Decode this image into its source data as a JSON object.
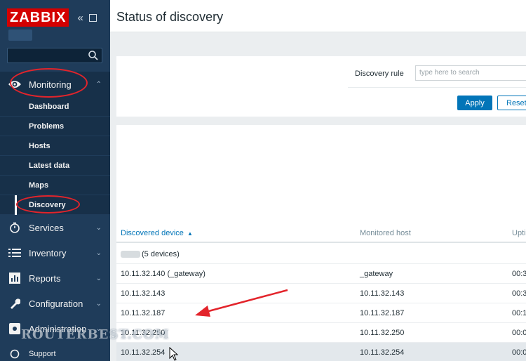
{
  "app": {
    "logo": "ZABBIX",
    "collapse_icon": "«",
    "kiosk_icon": "□"
  },
  "sidebar": {
    "search_placeholder": "",
    "items": [
      {
        "label": "Monitoring",
        "icon": "eye-icon",
        "chevron": "⌃",
        "expanded": true,
        "children": [
          {
            "label": "Dashboard"
          },
          {
            "label": "Problems"
          },
          {
            "label": "Hosts"
          },
          {
            "label": "Latest data"
          },
          {
            "label": "Maps"
          },
          {
            "label": "Discovery",
            "selected": true
          }
        ]
      },
      {
        "label": "Services",
        "icon": "stopwatch-icon",
        "chevron": "⌄"
      },
      {
        "label": "Inventory",
        "icon": "list-icon",
        "chevron": "⌄"
      },
      {
        "label": "Reports",
        "icon": "bar-chart-icon",
        "chevron": "⌄"
      },
      {
        "label": "Configuration",
        "icon": "wrench-icon",
        "chevron": "⌄"
      },
      {
        "label": "Administration",
        "icon": "gear-icon",
        "chevron": "⌄"
      },
      {
        "label": "Support",
        "icon": "support-icon",
        "chevron": ""
      }
    ]
  },
  "header": {
    "title": "Status of discovery"
  },
  "filter": {
    "discovery_rule_label": "Discovery rule",
    "discovery_rule_placeholder": "type here to search",
    "apply_label": "Apply",
    "reset_label": "Reset"
  },
  "table": {
    "columns": [
      {
        "label": "Discovered device",
        "sort": "▲"
      },
      {
        "label": "Monitored host"
      },
      {
        "label": "Upti"
      }
    ],
    "group_row": "(5 devices)",
    "rows": [
      {
        "device": "10.11.32.140 (_gateway)",
        "host": "_gateway",
        "uptime": "00:3"
      },
      {
        "device": "10.11.32.143",
        "host": "10.11.32.143",
        "uptime": "00:3"
      },
      {
        "device": "10.11.32.187",
        "host": "10.11.32.187",
        "uptime": "00:1"
      },
      {
        "device": "10.11.32.250",
        "host": "10.11.32.250",
        "uptime": "00:0"
      },
      {
        "device": "10.11.32.254",
        "host": "10.11.32.254",
        "uptime": "00:0"
      }
    ]
  },
  "overlay": {
    "watermark": "ROUTERBEST.COM",
    "annotation_color": "#e3242b"
  }
}
